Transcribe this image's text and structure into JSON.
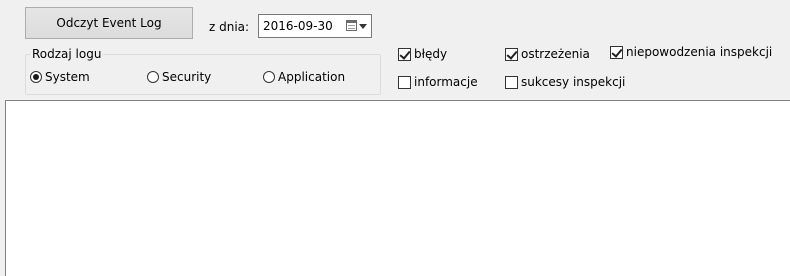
{
  "toolbar": {
    "read_button_label": "Odczyt Event Log",
    "date_label": "z dnia:",
    "date_value": "2016-09-30"
  },
  "log_type": {
    "legend": "Rodzaj logu",
    "options": [
      {
        "label": "System",
        "selected": true
      },
      {
        "label": "Security",
        "selected": false
      },
      {
        "label": "Application",
        "selected": false
      }
    ]
  },
  "filters": {
    "errors": {
      "label": "błędy",
      "checked": true
    },
    "warnings": {
      "label": "ostrzeżenia",
      "checked": true
    },
    "audit_failures": {
      "label": "niepowodzenia inspekcji",
      "checked": true
    },
    "information": {
      "label": "informacje",
      "checked": false
    },
    "audit_successes": {
      "label": "sukcesy inspekcji",
      "checked": false
    }
  },
  "icons": {
    "calendar": "calendar-icon",
    "dropdown": "chevron-down-icon"
  }
}
